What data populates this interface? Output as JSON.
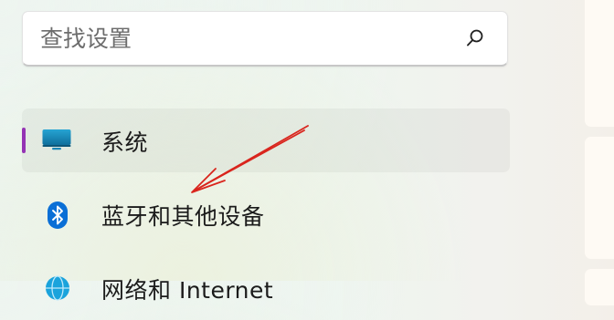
{
  "search": {
    "placeholder": "查找设置",
    "value": ""
  },
  "nav": {
    "items": [
      {
        "label": "系统",
        "icon": "display-icon",
        "selected": true
      },
      {
        "label": "蓝牙和其他设备",
        "icon": "bluetooth-icon",
        "selected": false
      },
      {
        "label": "网络和 Internet",
        "icon": "network-icon",
        "selected": false
      }
    ]
  },
  "colors": {
    "selection_indicator": "#9433b4",
    "bluetooth_blue": "#0a6fd6",
    "display_teal": "#1487b0",
    "annotation_arrow": "#d9251d"
  }
}
